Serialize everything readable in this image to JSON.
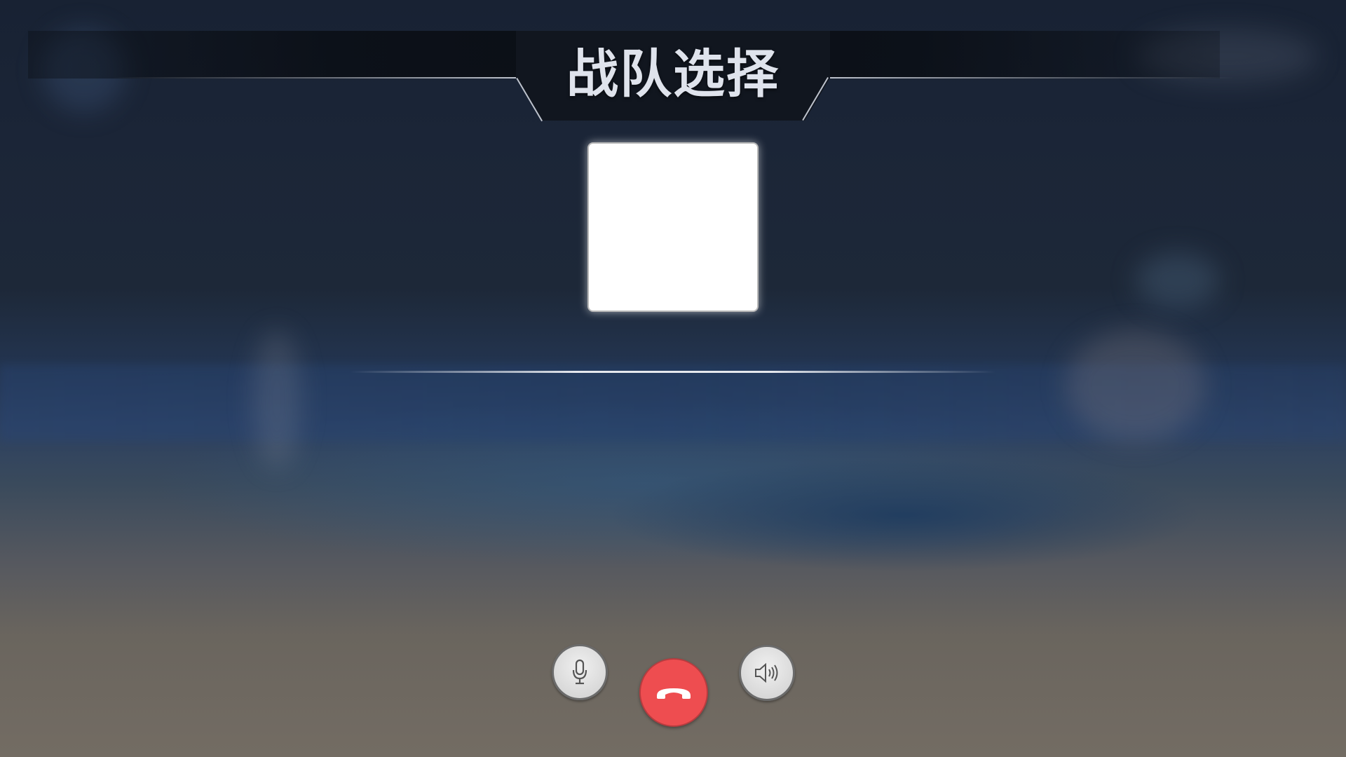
{
  "header": {
    "title": "战队选择"
  },
  "call_controls": {
    "microphone_icon": "microphone-icon",
    "hangup_icon": "phone-hangup-icon",
    "speaker_icon": "speaker-icon",
    "hangup_color": "#ee4d50"
  },
  "avatar": {
    "color": "#ffffff"
  }
}
